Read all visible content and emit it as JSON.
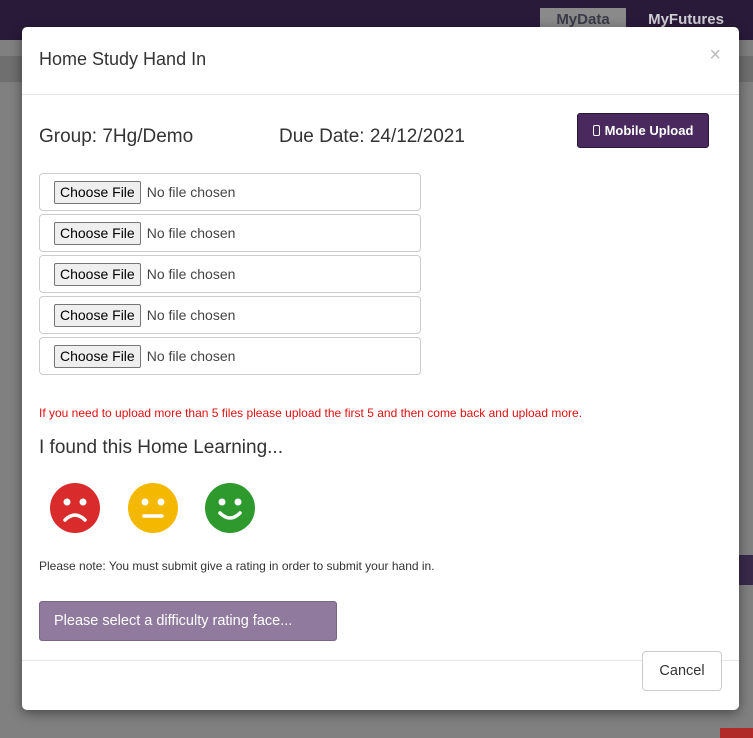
{
  "background": {
    "nav_mydata": "MyData",
    "nav_myfutures": "MyFutures"
  },
  "modal": {
    "title": "Home Study Hand In",
    "close_label": "×",
    "group": "Group: 7Hg/Demo",
    "due_date": "Due Date: 24/12/2021",
    "mobile_upload_label": "Mobile Upload",
    "files": [
      {
        "button": "Choose File",
        "status": "No file chosen"
      },
      {
        "button": "Choose File",
        "status": "No file chosen"
      },
      {
        "button": "Choose File",
        "status": "No file chosen"
      },
      {
        "button": "Choose File",
        "status": "No file chosen"
      },
      {
        "button": "Choose File",
        "status": "No file chosen"
      }
    ],
    "warning": "If you need to upload more than 5 files please upload the first 5 and then come back and upload more.",
    "found_title": "I found this Home Learning...",
    "faces": [
      {
        "icon": "sad-face-icon",
        "color": "#d92b2b"
      },
      {
        "icon": "neutral-face-icon",
        "color": "#f5b800"
      },
      {
        "icon": "happy-face-icon",
        "color": "#2e9a2e"
      }
    ],
    "note": "Please note: You must submit give a rating in order to submit your hand in.",
    "submit_label": "Please select a difficulty rating face...",
    "cancel_label": "Cancel"
  },
  "colors": {
    "accent": "#4a2a5e",
    "warning": "#e01010"
  }
}
